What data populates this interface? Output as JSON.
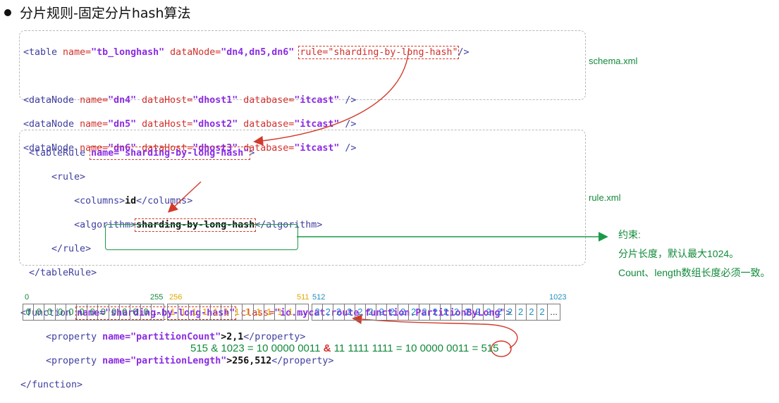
{
  "title": "分片规则-固定分片hash算法",
  "schema": {
    "label": "schema.xml",
    "line1": {
      "tag": "<table",
      "n": " name=",
      "nv": "\"tb_longhash\"",
      "dn": " dataNode=",
      "dnv": "\"dn4,dn5,dn6\"",
      "rule": "rule=\"sharding-by-long-hash\"",
      "end": "/>"
    },
    "nodes": [
      {
        "name": "\"dn4\"",
        "host": "\"dhost1\"",
        "db": "\"itcast\""
      },
      {
        "name": "\"dn5\"",
        "host": "\"dhost2\"",
        "db": "\"itcast\""
      },
      {
        "name": "\"dn6\"",
        "host": "\"dhost3\"",
        "db": "\"itcast\""
      }
    ],
    "node_tag": "<dataNode",
    "kw_name": " name=",
    "kw_host": " dataHost=",
    "kw_db": " database=",
    "node_end": " />"
  },
  "rule": {
    "label": "rule.xml",
    "tableRule_open": "<tableRule",
    "tableRule_name": "name=\"sharding-by-long-hash\"",
    "tableRule_gt": ">",
    "rule_open": "<rule>",
    "columns_open": "<columns>",
    "columns_val": "id",
    "columns_close": "</columns>",
    "algorithm_open": "<algorithm>",
    "algorithm_val": "sharding-by-long-hash",
    "algorithm_close": "</algorithm>",
    "rule_close": "</rule>",
    "tableRule_close": "</tableRule>",
    "function_open": "<function",
    "function_name": "name=\"sharding-by-long-hash\"",
    "function_class": " class=",
    "function_classv": "\"io.mycat.route.function.PartitionByLong\"",
    "function_gt": ">",
    "prop_open": "<property",
    "prop1_name": "name=\"partitionCount\"",
    "prop1_val": ">2,1",
    "prop2_name": "name=\"partitionLength\"",
    "prop2_val": ">256,512",
    "prop_close": "</property>",
    "function_close": "</function>"
  },
  "constraint": {
    "heading": "约束:",
    "line1": "分片长度，默认最大1024。",
    "line2": "Count、length数组长度必须一致。"
  },
  "partition_bar": {
    "label_0": "0",
    "label_255": "255",
    "label_256": "256",
    "label_511": "511",
    "label_512": "512",
    "label_1023": "1023",
    "group1_value": "0",
    "group2_value": "1",
    "group3_value": "2",
    "ellipsis": "...",
    "group1_color": "#118a3a",
    "group2_color": "#e0a800",
    "group3_color": "#1f8fc0"
  },
  "formula": {
    "left": "515 & 1023 = 10 0000 0011 ",
    "amp": "&",
    "right": " 11 1111 1111 = 10 0000 0011 = ",
    "result": "515"
  }
}
